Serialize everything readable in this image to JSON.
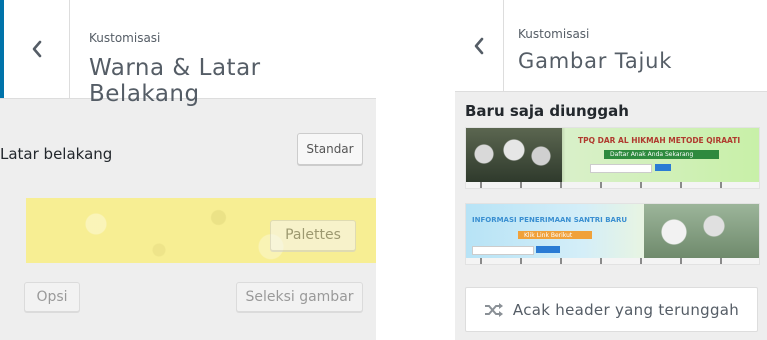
{
  "left_panel": {
    "header": {
      "eyebrow": "Kustomisasi",
      "title": "Warna & Latar Belakang"
    },
    "background_label": "Latar belakang",
    "default_button": "Standar",
    "palettes_button": "Palettes",
    "options_button": "Opsi",
    "select_image_button": "Seleksi gambar",
    "swatch_color": "#f7ee93",
    "accent_color": "#0073aa"
  },
  "right_panel": {
    "header": {
      "eyebrow": "Kustomisasi",
      "title": "Gambar Tajuk"
    },
    "recent_heading": "Baru saja diunggah",
    "headers": [
      {
        "title": "TPQ DAR AL HIKMAH METODE QIRAATI",
        "subtitle": "Daftar Anak Anda Sekarang"
      },
      {
        "title": "INFORMASI PENERIMAAN SANTRI BARU",
        "subtitle": "Klik Link Berikut"
      }
    ],
    "shuffle_button": "Acak header yang terunggah",
    "shuffle_icon": "shuffle-icon"
  }
}
